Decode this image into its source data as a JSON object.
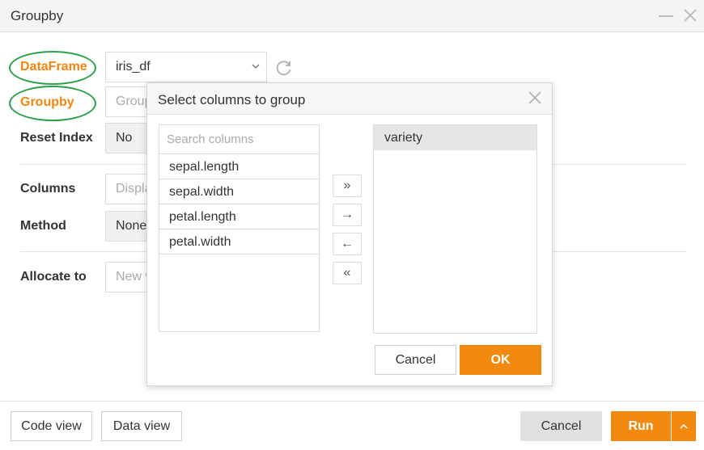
{
  "window": {
    "title": "Groupby"
  },
  "form": {
    "dataframe_label": "DataFrame",
    "dataframe_value": "iris_df",
    "groupby_label": "Groupby",
    "groupby_placeholder": "Group",
    "reset_index_label": "Reset Index",
    "reset_index_value": "No",
    "columns_label": "Columns",
    "columns_placeholder": "Displa",
    "method_label": "Method",
    "method_value": "None",
    "allocate_label": "Allocate to",
    "allocate_placeholder": "New v"
  },
  "popup": {
    "title": "Select columns to group",
    "search_placeholder": "Search columns",
    "available_columns": [
      "sepal.length",
      "sepal.width",
      "petal.length",
      "petal.width"
    ],
    "selected_columns": [
      "variety"
    ],
    "move_all_right": "»",
    "move_right": "→",
    "move_left": "←",
    "move_all_left": "«",
    "cancel_label": "Cancel",
    "ok_label": "OK"
  },
  "footer": {
    "code_view_label": "Code view",
    "data_view_label": "Data view",
    "cancel_label": "Cancel",
    "run_label": "Run",
    "run_more_icon": "chevron-up-icon"
  },
  "colors": {
    "accent": "#f28a12",
    "label_highlight": "#f0860f",
    "annotation_oval": "#2aa147"
  }
}
